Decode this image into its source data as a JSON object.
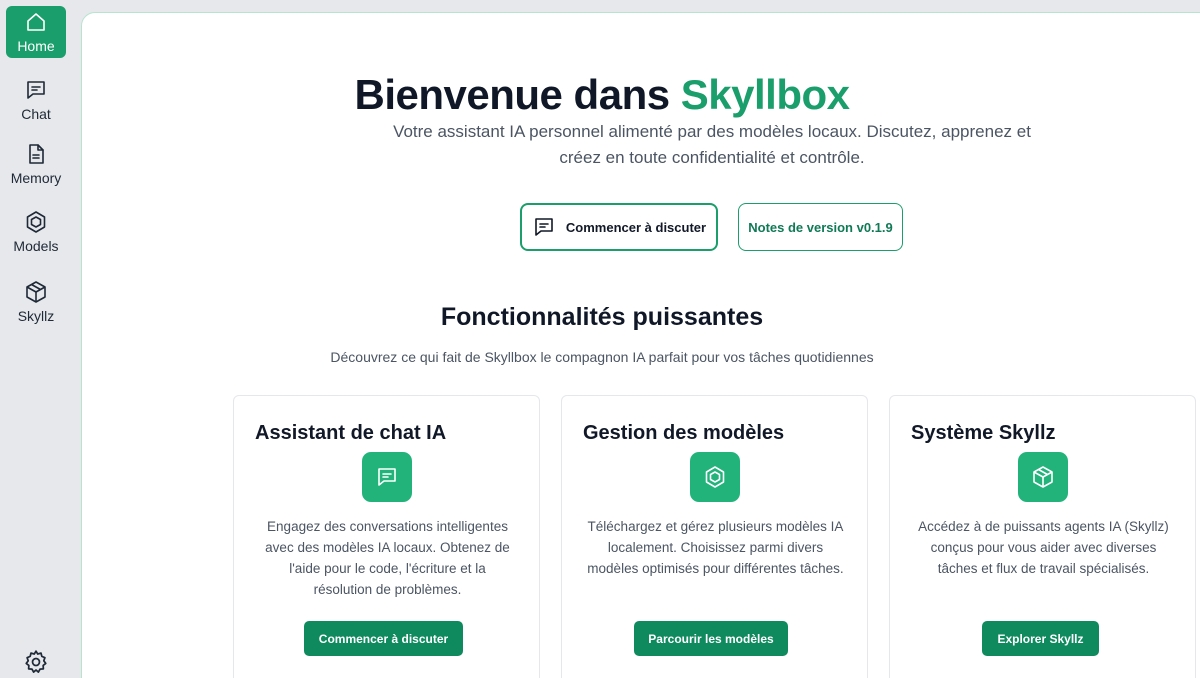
{
  "sidebar": {
    "items": [
      {
        "label": "Home"
      },
      {
        "label": "Chat"
      },
      {
        "label": "Memory"
      },
      {
        "label": "Models"
      },
      {
        "label": "Skyllz"
      }
    ]
  },
  "hero": {
    "title_prefix": "Bienvenue dans ",
    "title_accent": "Skyllbox",
    "subtitle": "Votre assistant IA personnel alimenté par des modèles locaux. Discutez, apprenez et créez en toute confidentialité et contrôle.",
    "start_chat_label": "Commencer à discuter",
    "release_notes_label": "Notes de version v0.1.9"
  },
  "features": {
    "title": "Fonctionnalités puissantes",
    "subtitle": "Découvrez ce qui fait de Skyllbox le compagnon IA parfait pour vos tâches quotidiennes",
    "cards": [
      {
        "title": "Assistant de chat IA",
        "icon": "chat-icon",
        "text": "Engagez des conversations intelligentes avec des modèles IA locaux. Obtenez de l'aide pour le code, l'écriture et la résolution de problèmes.",
        "button": "Commencer à discuter"
      },
      {
        "title": "Gestion des modèles",
        "icon": "hexagon-icon",
        "text": "Téléchargez et gérez plusieurs modèles IA localement. Choisissez parmi divers modèles optimisés pour différentes tâches.",
        "button": "Parcourir les modèles"
      },
      {
        "title": "Système Skyllz",
        "icon": "box-icon",
        "text": "Accédez à de puissants agents IA (Skyllz) conçus pour vous aider avec diverses tâches et flux de travail spécialisés.",
        "button": "Explorer Skyllz"
      }
    ]
  },
  "colors": {
    "accent": "#1a9e6b",
    "accent_dark": "#0f8a5f",
    "icon_bg": "#22b37b"
  }
}
